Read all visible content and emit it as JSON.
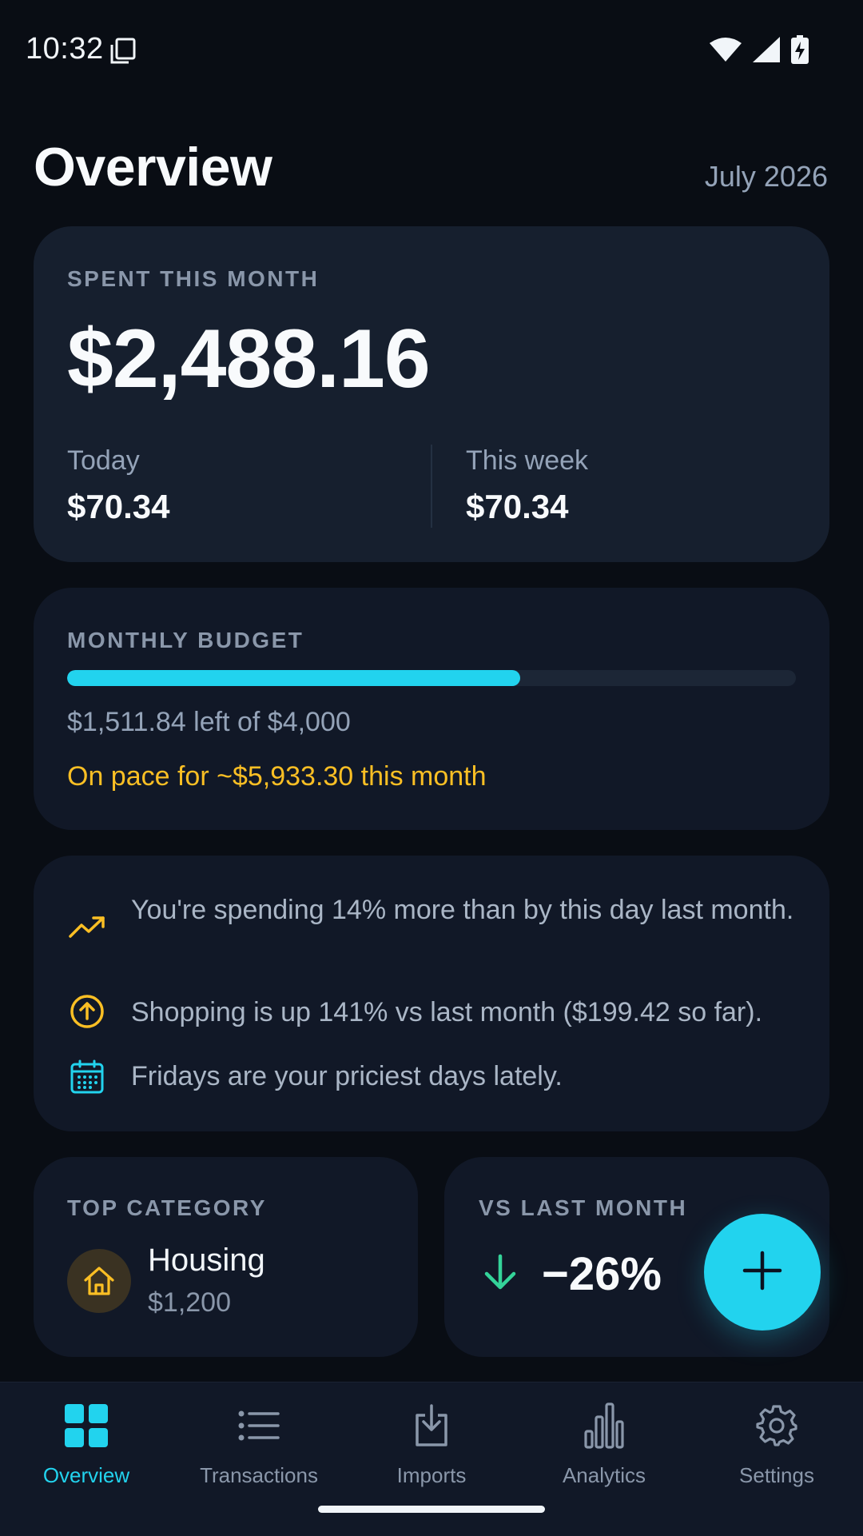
{
  "status_bar": {
    "time": "10:32"
  },
  "header": {
    "title": "Overview",
    "month": "July 2026"
  },
  "spent_card": {
    "label": "SPENT THIS MONTH",
    "amount": "$2,488.16",
    "today_label": "Today",
    "today_value": "$70.34",
    "week_label": "This week",
    "week_value": "$70.34"
  },
  "budget_card": {
    "label": "MONTHLY BUDGET",
    "progress_fraction": 0.622,
    "left_text": "$1,511.84 left of $4,000",
    "pace_text": "On pace for ~$5,933.30 this month"
  },
  "insights": [
    {
      "icon": "trending-up-icon",
      "text": "You're spending 14% more than by this day last month."
    },
    {
      "icon": "arrow-up-circle-icon",
      "text": "Shopping is up 141% vs last month ($199.42 so far)."
    },
    {
      "icon": "calendar-icon",
      "text": "Fridays are your priciest days lately."
    }
  ],
  "top_category": {
    "label": "TOP CATEGORY",
    "name": "Housing",
    "amount": "$1,200",
    "icon": "house-icon"
  },
  "vs_last_month": {
    "label": "VS LAST MONTH",
    "value": "−26%",
    "icon": "arrow-down-icon"
  },
  "fab": {
    "icon": "plus-icon"
  },
  "nav": {
    "items": [
      {
        "label": "Overview",
        "icon": "grid-icon",
        "active": true
      },
      {
        "label": "Transactions",
        "icon": "list-icon",
        "active": false
      },
      {
        "label": "Imports",
        "icon": "download-icon",
        "active": false
      },
      {
        "label": "Analytics",
        "icon": "bar-chart-icon",
        "active": false
      },
      {
        "label": "Settings",
        "icon": "gear-icon",
        "active": false
      }
    ]
  },
  "colors": {
    "accent": "#22d3ee",
    "warning": "#fbbf24",
    "positive": "#34d399",
    "background": "#090d14",
    "card": "#161f2e"
  }
}
